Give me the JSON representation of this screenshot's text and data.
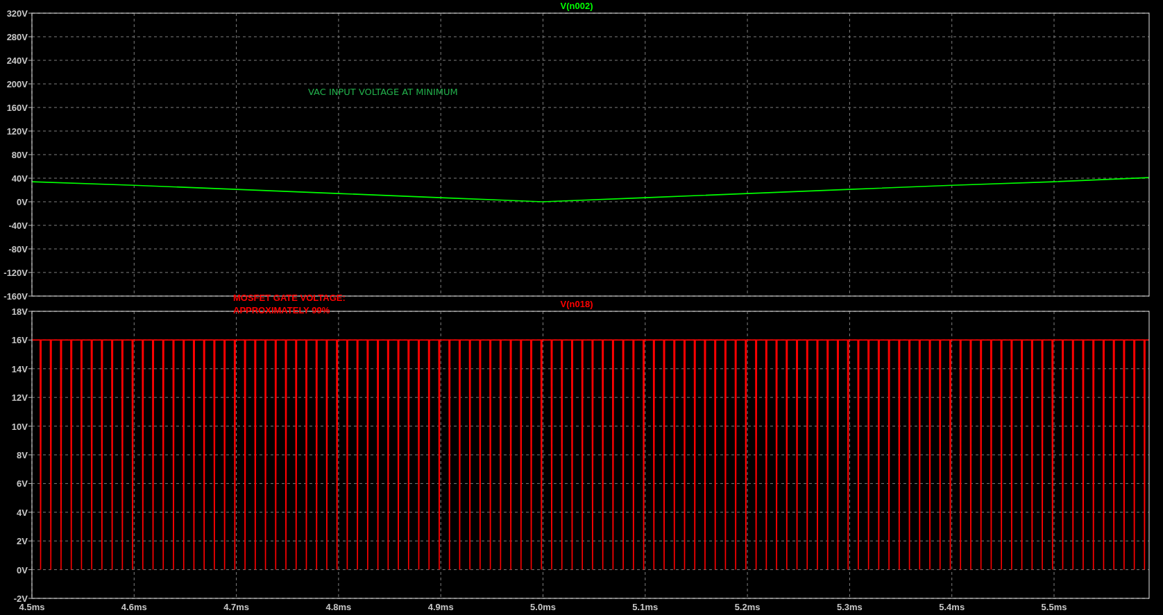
{
  "panes": [
    {
      "chart_data": {
        "type": "line",
        "grid": true,
        "xlim": [
          4.5,
          5.593
        ],
        "ylim": [
          -160,
          320
        ],
        "yticks": [
          {
            "value": 320,
            "label": "320V"
          },
          {
            "value": 280,
            "label": "280V"
          },
          {
            "value": 240,
            "label": "240V"
          },
          {
            "value": 200,
            "label": "200V"
          },
          {
            "value": 160,
            "label": "160V"
          },
          {
            "value": 120,
            "label": "120V"
          },
          {
            "value": 80,
            "label": "80V"
          },
          {
            "value": 40,
            "label": "40V"
          },
          {
            "value": 0,
            "label": "0V"
          },
          {
            "value": -40,
            "label": "-40V"
          },
          {
            "value": -80,
            "label": "-80V"
          },
          {
            "value": -120,
            "label": "-120V"
          },
          {
            "value": -160,
            "label": "-160V"
          }
        ],
        "x": [
          4.5,
          4.6,
          4.7,
          4.8,
          4.9,
          5.0,
          5.1,
          5.2,
          5.3,
          5.4,
          5.5,
          5.593
        ],
        "series": [
          {
            "name": "V(n002)",
            "color": "#00ff00",
            "values": [
              34,
              28,
              21,
              14,
              7,
              0,
              7,
              14,
              21,
              28,
              34,
              41
            ]
          }
        ],
        "annotations": [
          "VAC INPUT VOLTAGE AT MINIMUM"
        ]
      }
    },
    {
      "chart_data": {
        "type": "line",
        "grid": true,
        "xlim": [
          4.5,
          5.593
        ],
        "ylim": [
          -2,
          18
        ],
        "xticks": [
          {
            "value": 4.5,
            "label": "4.5ms"
          },
          {
            "value": 4.6,
            "label": "4.6ms"
          },
          {
            "value": 4.7,
            "label": "4.7ms"
          },
          {
            "value": 4.8,
            "label": "4.8ms"
          },
          {
            "value": 4.9,
            "label": "4.9ms"
          },
          {
            "value": 5.0,
            "label": "5.0ms"
          },
          {
            "value": 5.1,
            "label": "5.1ms"
          },
          {
            "value": 5.2,
            "label": "5.2ms"
          },
          {
            "value": 5.3,
            "label": "5.3ms"
          },
          {
            "value": 5.4,
            "label": "5.4ms"
          },
          {
            "value": 5.5,
            "label": "5.5ms"
          }
        ],
        "yticks": [
          {
            "value": 18,
            "label": "18V"
          },
          {
            "value": 16,
            "label": "16V"
          },
          {
            "value": 14,
            "label": "14V"
          },
          {
            "value": 12,
            "label": "12V"
          },
          {
            "value": 10,
            "label": "10V"
          },
          {
            "value": 8,
            "label": "8V"
          },
          {
            "value": 6,
            "label": "6V"
          },
          {
            "value": 4,
            "label": "4V"
          },
          {
            "value": 2,
            "label": "2V"
          },
          {
            "value": 0,
            "label": "0V"
          },
          {
            "value": -2,
            "label": "-2V"
          }
        ],
        "x": [
          4.5,
          4.508,
          4.5085,
          4.509,
          4.518,
          4.5185,
          4.519,
          4.528,
          4.5285,
          4.529,
          4.538,
          4.5385,
          4.539,
          4.548,
          4.5485,
          4.549,
          4.558,
          4.5585,
          4.559,
          4.568,
          4.5685,
          4.569,
          4.578,
          4.5785,
          4.579,
          4.588,
          4.5885,
          4.589,
          4.598,
          4.5985,
          4.599,
          4.608,
          4.6085,
          4.609,
          4.618,
          4.6185,
          4.619,
          4.628,
          4.6285,
          4.629,
          4.638,
          4.6385,
          4.639,
          4.648,
          4.6485,
          4.649,
          4.658,
          4.6585,
          4.659,
          4.668,
          4.6685,
          4.669,
          4.678,
          4.6785,
          4.679,
          4.688,
          4.6885,
          4.689,
          4.698,
          4.6985,
          4.699,
          4.708,
          4.7085,
          4.709,
          4.718,
          4.7185,
          4.719,
          4.728,
          4.7285,
          4.729,
          4.738,
          4.7385,
          4.739,
          4.748,
          4.7485,
          4.749,
          4.758,
          4.7585,
          4.759,
          4.768,
          4.7685,
          4.769,
          4.778,
          4.7785,
          4.779,
          4.788,
          4.7885,
          4.789,
          4.798,
          4.7985,
          4.799,
          4.808,
          4.8085,
          4.809,
          4.818,
          4.8185,
          4.819,
          4.828,
          4.8285,
          4.829,
          4.838,
          4.8385,
          4.839,
          4.848,
          4.8485,
          4.849,
          4.858,
          4.8585,
          4.859,
          4.868,
          4.8685,
          4.869,
          4.878,
          4.8785,
          4.879,
          4.888,
          4.8885,
          4.889,
          4.898,
          4.8985,
          4.899,
          4.908,
          4.9085,
          4.909,
          4.918,
          4.9185,
          4.919,
          4.928,
          4.9285,
          4.929,
          4.938,
          4.9385,
          4.939,
          4.948,
          4.9485,
          4.949,
          4.958,
          4.9585,
          4.959,
          4.968,
          4.9685,
          4.969,
          4.978,
          4.9785,
          4.979,
          4.988,
          4.9885,
          4.989,
          4.998,
          4.9985,
          4.999,
          5.008,
          5.0085,
          5.009,
          5.018,
          5.0185,
          5.019,
          5.028,
          5.0285,
          5.029,
          5.038,
          5.0385,
          5.039,
          5.048,
          5.0485,
          5.049,
          5.058,
          5.0585,
          5.059,
          5.068,
          5.0685,
          5.069,
          5.078,
          5.0785,
          5.079,
          5.088,
          5.0885,
          5.089,
          5.098,
          5.0985,
          5.099,
          5.108,
          5.1085,
          5.109,
          5.118,
          5.1185,
          5.119,
          5.128,
          5.1285,
          5.129,
          5.138,
          5.1385,
          5.139,
          5.148,
          5.1485,
          5.149,
          5.158,
          5.1585,
          5.159,
          5.168,
          5.1685,
          5.169,
          5.178,
          5.1785,
          5.179,
          5.188,
          5.1885,
          5.189,
          5.198,
          5.1985,
          5.199,
          5.208,
          5.2085,
          5.209,
          5.218,
          5.2185,
          5.219,
          5.228,
          5.2285,
          5.229,
          5.238,
          5.2385,
          5.239,
          5.248,
          5.2485,
          5.249,
          5.258,
          5.2585,
          5.259,
          5.268,
          5.2685,
          5.269,
          5.278,
          5.2785,
          5.279,
          5.288,
          5.2885,
          5.289,
          5.298,
          5.2985,
          5.299,
          5.308,
          5.3085,
          5.309,
          5.318,
          5.3185,
          5.319,
          5.328,
          5.3285,
          5.329,
          5.338,
          5.3385,
          5.339,
          5.348,
          5.3485,
          5.349,
          5.358,
          5.3585,
          5.359,
          5.368,
          5.3685,
          5.369,
          5.378,
          5.3785,
          5.379,
          5.388,
          5.3885,
          5.389,
          5.398,
          5.3985,
          5.399,
          5.408,
          5.4085,
          5.409,
          5.418,
          5.4185,
          5.419,
          5.428,
          5.4285,
          5.429,
          5.438,
          5.4385,
          5.439,
          5.448,
          5.4485,
          5.449,
          5.458,
          5.4585,
          5.459,
          5.468,
          5.4685,
          5.469,
          5.478,
          5.4785,
          5.479,
          5.488,
          5.4885,
          5.489,
          5.498,
          5.4985,
          5.499,
          5.508,
          5.5085,
          5.509,
          5.518,
          5.5185,
          5.519,
          5.528,
          5.5285,
          5.529,
          5.538,
          5.5385,
          5.539,
          5.548,
          5.5485,
          5.549,
          5.558,
          5.5585,
          5.559,
          5.568,
          5.5685,
          5.569,
          5.578,
          5.5785,
          5.579,
          5.588,
          5.5885,
          5.589,
          5.593
        ],
        "series": [
          {
            "name": "V(n018)",
            "color": "#ff0000",
            "values": [
              16,
              16,
              0,
              16,
              16,
              0,
              16,
              16,
              0,
              16,
              16,
              0,
              16,
              16,
              0,
              16,
              16,
              0,
              16,
              16,
              0,
              16,
              16,
              0,
              16,
              16,
              0,
              16,
              16,
              0,
              16,
              16,
              0,
              16,
              16,
              0,
              16,
              16,
              0,
              16,
              16,
              0,
              16,
              16,
              0,
              16,
              16,
              0,
              16,
              16,
              0,
              16,
              16,
              0,
              16,
              16,
              0,
              16,
              16,
              0,
              16,
              16,
              0,
              16,
              16,
              0,
              16,
              16,
              0,
              16,
              16,
              0,
              16,
              16,
              0,
              16,
              16,
              0,
              16,
              16,
              0,
              16,
              16,
              0,
              16,
              16,
              0,
              16,
              16,
              0,
              16,
              16,
              0,
              16,
              16,
              0,
              16,
              16,
              0,
              16,
              16,
              0,
              16,
              16,
              0,
              16,
              16,
              0,
              16,
              16,
              0,
              16,
              16,
              0,
              16,
              16,
              0,
              16,
              16,
              0,
              16,
              16,
              0,
              16,
              16,
              0,
              16,
              16,
              0,
              16,
              16,
              0,
              16,
              16,
              0,
              16,
              16,
              0,
              16,
              16,
              0,
              16,
              16,
              0,
              16,
              16,
              0,
              16,
              16,
              0,
              16,
              16,
              0,
              16,
              16,
              0,
              16,
              16,
              0,
              16,
              16,
              0,
              16,
              16,
              0,
              16,
              16,
              0,
              16,
              16,
              0,
              16,
              16,
              0,
              16,
              16,
              0,
              16,
              16,
              0,
              16,
              16,
              0,
              16,
              16,
              0,
              16,
              16,
              0,
              16,
              16,
              0,
              16,
              16,
              0,
              16,
              16,
              0,
              16,
              16,
              0,
              16,
              16,
              0,
              16,
              16,
              0,
              16,
              16,
              0,
              16,
              16,
              0,
              16,
              16,
              0,
              16,
              16,
              0,
              16,
              16,
              0,
              16,
              16,
              0,
              16,
              16,
              0,
              16,
              16,
              0,
              16,
              16,
              0,
              16,
              16,
              0,
              16,
              16,
              0,
              16,
              16,
              0,
              16,
              16,
              0,
              16,
              16,
              0,
              16,
              16,
              0,
              16,
              16,
              0,
              16,
              16,
              0,
              16,
              16,
              0,
              16,
              16,
              0,
              16,
              16,
              0,
              16,
              16,
              0,
              16,
              16,
              0,
              16,
              16,
              0,
              16,
              16,
              0,
              16,
              16,
              0,
              16,
              16,
              0,
              16,
              16,
              0,
              16,
              16,
              0,
              16,
              16,
              0,
              16,
              16,
              0,
              16,
              16,
              0,
              16,
              16,
              0,
              16,
              16,
              0,
              16,
              16,
              0,
              16,
              16,
              0,
              16,
              16,
              0,
              16,
              16,
              0,
              16,
              16,
              0,
              16,
              16,
              0,
              16,
              16,
              0,
              16,
              16
            ]
          }
        ],
        "annotations": [
          "MOSFET GATE VOLTAGE:",
          "APPROXIMATELY 99%"
        ]
      }
    }
  ]
}
